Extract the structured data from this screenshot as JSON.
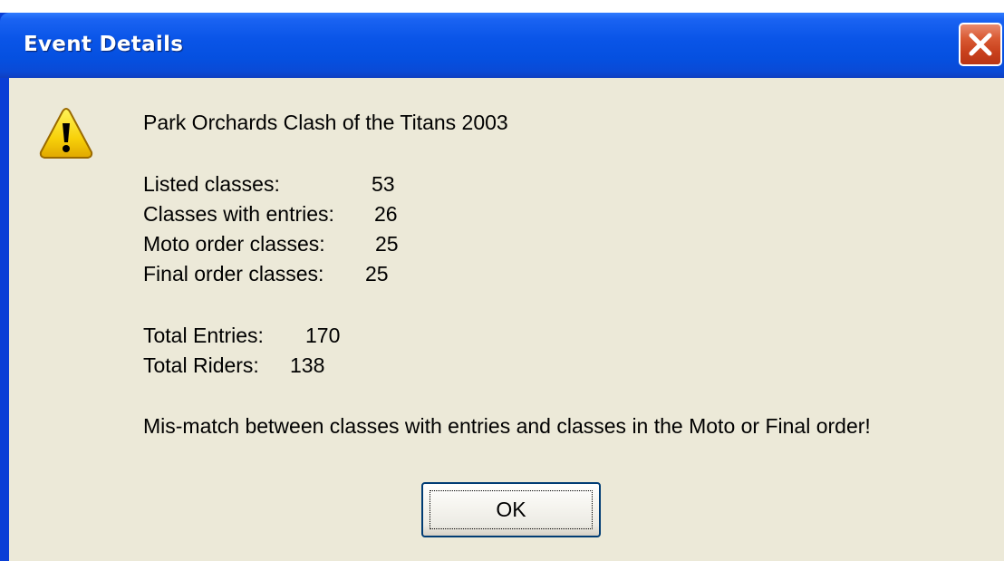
{
  "window": {
    "title": "Event Details",
    "close_icon": "close-icon"
  },
  "dialog": {
    "icon": "warning-icon",
    "event_name": "Park Orchards Clash of the Titans 2003",
    "stats": [
      {
        "label": "Listed classes:",
        "value": "53"
      },
      {
        "label": "Classes with entries:",
        "value": "26"
      },
      {
        "label": "Moto order classes:",
        "value": "25"
      },
      {
        "label": "Final order classes:",
        "value": "25"
      }
    ],
    "totals": [
      {
        "label": "Total Entries:",
        "value": "170"
      },
      {
        "label": "Total Riders:",
        "value": "138"
      }
    ],
    "warning_message": "Mis-match between classes with entries and classes in the Moto or Final order!",
    "ok_label": "OK"
  },
  "colors": {
    "titlebar": "#0a55e8",
    "client_background": "#ece9d8",
    "close_button": "#d95a33"
  }
}
